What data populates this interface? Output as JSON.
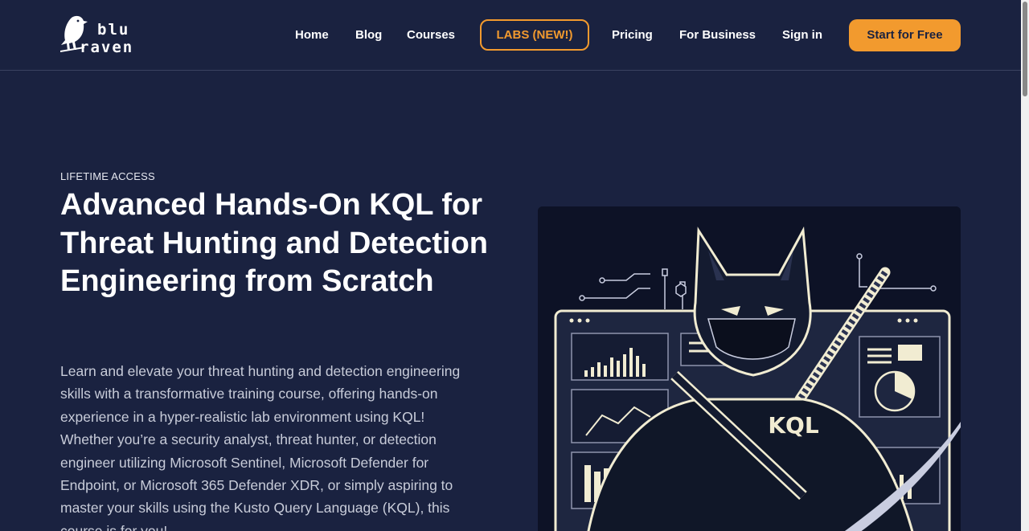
{
  "brand": {
    "line1": "blu",
    "line2": "raven"
  },
  "nav": {
    "home": "Home",
    "blog": "Blog",
    "courses": "Courses",
    "labs": "LABS (NEW!)",
    "pricing": "Pricing",
    "business": "For Business",
    "signin": "Sign in",
    "cta": "Start for Free"
  },
  "hero": {
    "eyebrow": "LIFETIME ACCESS",
    "title": "Advanced Hands-On KQL for Threat Hunting and Detection Engineering from Scratch",
    "description": "Learn and elevate your threat hunting and detection engineering skills with a transformative training course, offering hands-on experience in a hyper-realistic lab environment using KQL! Whether you’re a security analyst, threat hunter, or detection engineer utilizing Microsoft Sentinel, Microsoft Defender for Endpoint, or Microsoft 365 Defender XDR, or simply aspiring to master your skills using the Kusto Query Language (KQL), this course is for you!",
    "image_label": "KQL"
  },
  "colors": {
    "background": "#1a2240",
    "accent": "#f29a2e",
    "text": "#ffffff"
  }
}
